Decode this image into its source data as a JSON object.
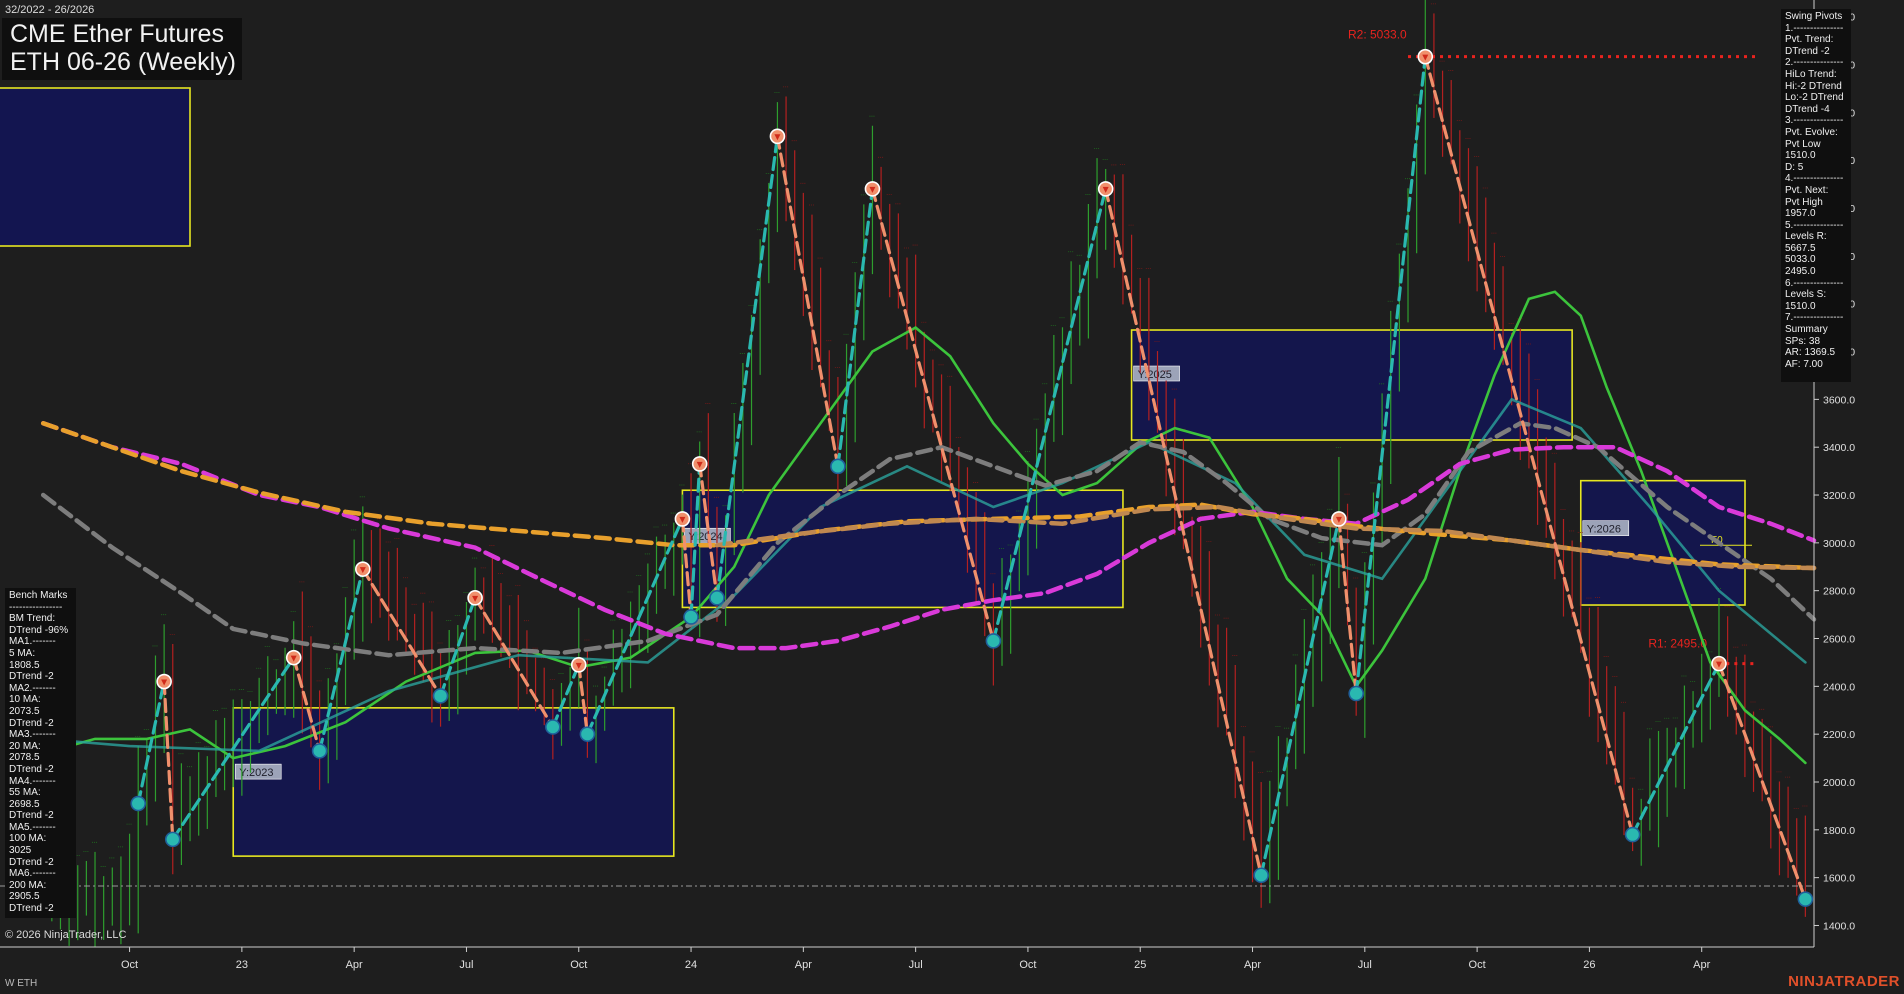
{
  "header": {
    "date_range": "32/2022 - 26/2026",
    "title_line1": "CME Ether Futures",
    "title_line2": "ETH 06-26 (Weekly)"
  },
  "footer": {
    "copyright": "© 2026 NinjaTrader, LLC",
    "symbol": "W ETH",
    "brand": "NINJATRADER"
  },
  "swing_pivots_panel": {
    "lines": [
      "Swing Pivots",
      "1.---------------",
      "Pvt. Trend:",
      "DTrend -2",
      "2.---------------",
      "HiLo Trend:",
      "Hi:-2 DTrend",
      "Lo:-2 DTrend",
      "DTrend -4",
      "3.---------------",
      "Pvt. Evolve:",
      "Pvt Low",
      "1510.0",
      "D: 5",
      "4.---------------",
      "Pvt. Next:",
      "Pvt High",
      "1957.0",
      "5.---------------",
      "Levels R:",
      "5667.5",
      "5033.0",
      "2495.0",
      "6.---------------",
      "Levels S:",
      "1510.0",
      "7.---------------",
      "Summary",
      "SPs: 38",
      "AR: 1369.5",
      "AF: 7.00"
    ]
  },
  "bench_marks_panel": {
    "lines": [
      "Bench Marks",
      "----------------",
      "BM Trend:",
      "DTrend -96%",
      "MA1.-------",
      "5 MA:",
      "1808.5",
      "DTrend -2",
      "MA2.-------",
      "10 MA:",
      "2073.5",
      "DTrend -2",
      "MA3.-------",
      "20 MA:",
      "2078.5",
      "DTrend -2",
      "MA4.-------",
      "55 MA:",
      "2698.5",
      "DTrend -2",
      "MA5.-------",
      "100 MA:",
      "3025",
      "DTrend -2",
      "MA6.-------",
      "200 MA:",
      "2905.5",
      "DTrend -2"
    ]
  },
  "chart_data": {
    "type": "line",
    "title": "CME Ether Futures ETH 06-26 (Weekly)",
    "y_ticks": [
      1400,
      1600,
      1800,
      2000,
      2200,
      2400,
      2600,
      2800,
      3000,
      3200,
      3400,
      3600,
      3800,
      4000,
      4200,
      4400,
      4600,
      4800,
      5000,
      5200
    ],
    "ylim": [
      1310,
      5270
    ],
    "x_ticks": [
      "Oct",
      "23",
      "Apr",
      "Jul",
      "Oct",
      "24",
      "Apr",
      "Jul",
      "Oct",
      "25",
      "Apr",
      "Jul",
      "Oct",
      "26",
      "Apr"
    ],
    "x_index_range": [
      0,
      198
    ],
    "x_tick_index": [
      10,
      23,
      36,
      49,
      62,
      75,
      88,
      101,
      114,
      127,
      140,
      153,
      166,
      179,
      192
    ],
    "levels": [
      {
        "label": "R2: 5033.0",
        "value": 5033,
        "from_index": 158,
        "color": "#e8231e"
      },
      {
        "label": "R1: 2495.0",
        "value": 2495,
        "from_index": 193,
        "color": "#e8231e"
      }
    ],
    "support_line": {
      "value": 1565,
      "color": "#9a9a9a"
    },
    "fib_label": "F0",
    "year_boxes": [
      {
        "label": "Y:2023",
        "x_from": 22,
        "x_to": 73,
        "y_from": 1690,
        "y_to": 2310
      },
      {
        "label": "Y:2024",
        "x_from": 74,
        "x_to": 125,
        "y_from": 2730,
        "y_to": 3220
      },
      {
        "label": "Y:2025",
        "x_from": 126,
        "x_to": 177,
        "y_from": 3430,
        "y_to": 3890
      },
      {
        "label": "Y:2026",
        "x_from": 178,
        "x_to": 203,
        "y_from": 2740,
        "y_to": 3260
      }
    ],
    "swing_pivots": [
      {
        "x": 11,
        "y": 1910,
        "type": "low"
      },
      {
        "x": 14,
        "y": 2420,
        "type": "high"
      },
      {
        "x": 15,
        "y": 1760,
        "type": "low"
      },
      {
        "x": 29,
        "y": 2520,
        "type": "high"
      },
      {
        "x": 32,
        "y": 2130,
        "type": "low"
      },
      {
        "x": 37,
        "y": 2890,
        "type": "high"
      },
      {
        "x": 46,
        "y": 2360,
        "type": "low"
      },
      {
        "x": 50,
        "y": 2770,
        "type": "high"
      },
      {
        "x": 59,
        "y": 2230,
        "type": "low"
      },
      {
        "x": 62,
        "y": 2490,
        "type": "high"
      },
      {
        "x": 63,
        "y": 2200,
        "type": "low"
      },
      {
        "x": 74,
        "y": 3100,
        "type": "high"
      },
      {
        "x": 75,
        "y": 2690,
        "type": "low"
      },
      {
        "x": 76,
        "y": 3330,
        "type": "high"
      },
      {
        "x": 78,
        "y": 2770,
        "type": "low"
      },
      {
        "x": 85,
        "y": 4700,
        "type": "high"
      },
      {
        "x": 92,
        "y": 3320,
        "type": "low"
      },
      {
        "x": 96,
        "y": 4480,
        "type": "high"
      },
      {
        "x": 110,
        "y": 2590,
        "type": "low"
      },
      {
        "x": 123,
        "y": 4480,
        "type": "high"
      },
      {
        "x": 141,
        "y": 1610,
        "type": "low"
      },
      {
        "x": 150,
        "y": 3100,
        "type": "high"
      },
      {
        "x": 152,
        "y": 2370,
        "type": "low"
      },
      {
        "x": 160,
        "y": 5033,
        "type": "high"
      },
      {
        "x": 184,
        "y": 1780,
        "type": "low"
      },
      {
        "x": 194,
        "y": 2495,
        "type": "high"
      },
      {
        "x": 204,
        "y": 1510,
        "type": "low"
      }
    ],
    "series": [
      {
        "name": "5 MA",
        "color": "#3cc43c",
        "dash": "solid",
        "points": [
          [
            -4,
            2350
          ],
          [
            0,
            2120
          ],
          [
            6,
            2180
          ],
          [
            12,
            2180
          ],
          [
            17,
            2220
          ],
          [
            22,
            2100
          ],
          [
            28,
            2150
          ],
          [
            35,
            2250
          ],
          [
            42,
            2420
          ],
          [
            50,
            2540
          ],
          [
            56,
            2550
          ],
          [
            62,
            2480
          ],
          [
            68,
            2520
          ],
          [
            75,
            2690
          ],
          [
            80,
            2900
          ],
          [
            84,
            3200
          ],
          [
            90,
            3500
          ],
          [
            96,
            3800
          ],
          [
            101,
            3900
          ],
          [
            105,
            3780
          ],
          [
            110,
            3500
          ],
          [
            114,
            3330
          ],
          [
            118,
            3200
          ],
          [
            122,
            3250
          ],
          [
            127,
            3410
          ],
          [
            131,
            3480
          ],
          [
            135,
            3440
          ],
          [
            140,
            3150
          ],
          [
            144,
            2850
          ],
          [
            148,
            2700
          ],
          [
            152,
            2400
          ],
          [
            155,
            2550
          ],
          [
            160,
            2850
          ],
          [
            164,
            3300
          ],
          [
            168,
            3700
          ],
          [
            172,
            4020
          ],
          [
            175,
            4050
          ],
          [
            178,
            3950
          ],
          [
            181,
            3650
          ],
          [
            185,
            3300
          ],
          [
            189,
            2900
          ],
          [
            193,
            2500
          ],
          [
            197,
            2300
          ],
          [
            201,
            2180
          ],
          [
            204,
            2080
          ]
        ]
      },
      {
        "name": "10 MA",
        "color": "#2aa39c",
        "dash": "solid",
        "points": [
          [
            0,
            2180
          ],
          [
            10,
            2150
          ],
          [
            25,
            2130
          ],
          [
            40,
            2380
          ],
          [
            55,
            2530
          ],
          [
            70,
            2500
          ],
          [
            80,
            2780
          ],
          [
            90,
            3150
          ],
          [
            100,
            3320
          ],
          [
            110,
            3150
          ],
          [
            118,
            3250
          ],
          [
            128,
            3420
          ],
          [
            138,
            3250
          ],
          [
            146,
            2950
          ],
          [
            155,
            2850
          ],
          [
            163,
            3250
          ],
          [
            170,
            3600
          ],
          [
            178,
            3480
          ],
          [
            186,
            3150
          ],
          [
            194,
            2800
          ],
          [
            204,
            2500
          ]
        ]
      },
      {
        "name": "20 MA",
        "color": "#7d7d7d",
        "dash": "dash",
        "points": [
          [
            0,
            3200
          ],
          [
            8,
            2980
          ],
          [
            16,
            2790
          ],
          [
            22,
            2640
          ],
          [
            30,
            2580
          ],
          [
            40,
            2530
          ],
          [
            50,
            2560
          ],
          [
            60,
            2540
          ],
          [
            70,
            2590
          ],
          [
            78,
            2700
          ],
          [
            85,
            3000
          ],
          [
            92,
            3200
          ],
          [
            98,
            3350
          ],
          [
            104,
            3400
          ],
          [
            110,
            3320
          ],
          [
            116,
            3240
          ],
          [
            122,
            3300
          ],
          [
            127,
            3420
          ],
          [
            132,
            3380
          ],
          [
            137,
            3250
          ],
          [
            142,
            3100
          ],
          [
            148,
            3020
          ],
          [
            155,
            2990
          ],
          [
            160,
            3120
          ],
          [
            165,
            3380
          ],
          [
            171,
            3500
          ],
          [
            175,
            3480
          ],
          [
            180,
            3400
          ],
          [
            188,
            3150
          ],
          [
            194,
            3000
          ],
          [
            200,
            2850
          ],
          [
            205,
            2680
          ]
        ]
      },
      {
        "name": "55 MA",
        "color": "#d93ad9",
        "dash": "dash",
        "points": [
          [
            0,
            3500
          ],
          [
            8,
            3400
          ],
          [
            16,
            3330
          ],
          [
            25,
            3200
          ],
          [
            32,
            3150
          ],
          [
            40,
            3060
          ],
          [
            50,
            2980
          ],
          [
            58,
            2840
          ],
          [
            65,
            2720
          ],
          [
            72,
            2620
          ],
          [
            80,
            2560
          ],
          [
            86,
            2560
          ],
          [
            92,
            2590
          ],
          [
            98,
            2650
          ],
          [
            104,
            2720
          ],
          [
            110,
            2760
          ],
          [
            116,
            2790
          ],
          [
            122,
            2870
          ],
          [
            128,
            3000
          ],
          [
            134,
            3100
          ],
          [
            140,
            3130
          ],
          [
            146,
            3100
          ],
          [
            152,
            3080
          ],
          [
            158,
            3180
          ],
          [
            164,
            3330
          ],
          [
            170,
            3390
          ],
          [
            176,
            3400
          ],
          [
            182,
            3400
          ],
          [
            188,
            3300
          ],
          [
            194,
            3150
          ],
          [
            200,
            3080
          ],
          [
            205,
            3010
          ]
        ]
      },
      {
        "name": "100 MA",
        "color": "#e8a02c",
        "dash": "dash",
        "points": [
          [
            0,
            3500
          ],
          [
            8,
            3400
          ],
          [
            16,
            3300
          ],
          [
            25,
            3210
          ],
          [
            35,
            3130
          ],
          [
            45,
            3080
          ],
          [
            55,
            3050
          ],
          [
            65,
            3020
          ],
          [
            73,
            2990
          ],
          [
            80,
            2990
          ],
          [
            90,
            3050
          ],
          [
            100,
            3090
          ],
          [
            110,
            3100
          ],
          [
            120,
            3110
          ],
          [
            128,
            3150
          ],
          [
            134,
            3160
          ],
          [
            140,
            3120
          ],
          [
            146,
            3100
          ],
          [
            152,
            3070
          ],
          [
            160,
            3040
          ],
          [
            170,
            3010
          ],
          [
            178,
            2970
          ],
          [
            186,
            2940
          ],
          [
            194,
            2910
          ],
          [
            205,
            2895
          ]
        ]
      },
      {
        "name": "200 MA",
        "color": "#c08850",
        "dash": "dash",
        "points": [
          [
            78,
            2990
          ],
          [
            88,
            3040
          ],
          [
            98,
            3080
          ],
          [
            108,
            3100
          ],
          [
            118,
            3080
          ],
          [
            128,
            3140
          ],
          [
            136,
            3150
          ],
          [
            144,
            3100
          ],
          [
            152,
            3060
          ],
          [
            162,
            3050
          ],
          [
            172,
            3000
          ],
          [
            180,
            2960
          ],
          [
            188,
            2920
          ],
          [
            196,
            2900
          ],
          [
            205,
            2895
          ]
        ]
      }
    ]
  }
}
